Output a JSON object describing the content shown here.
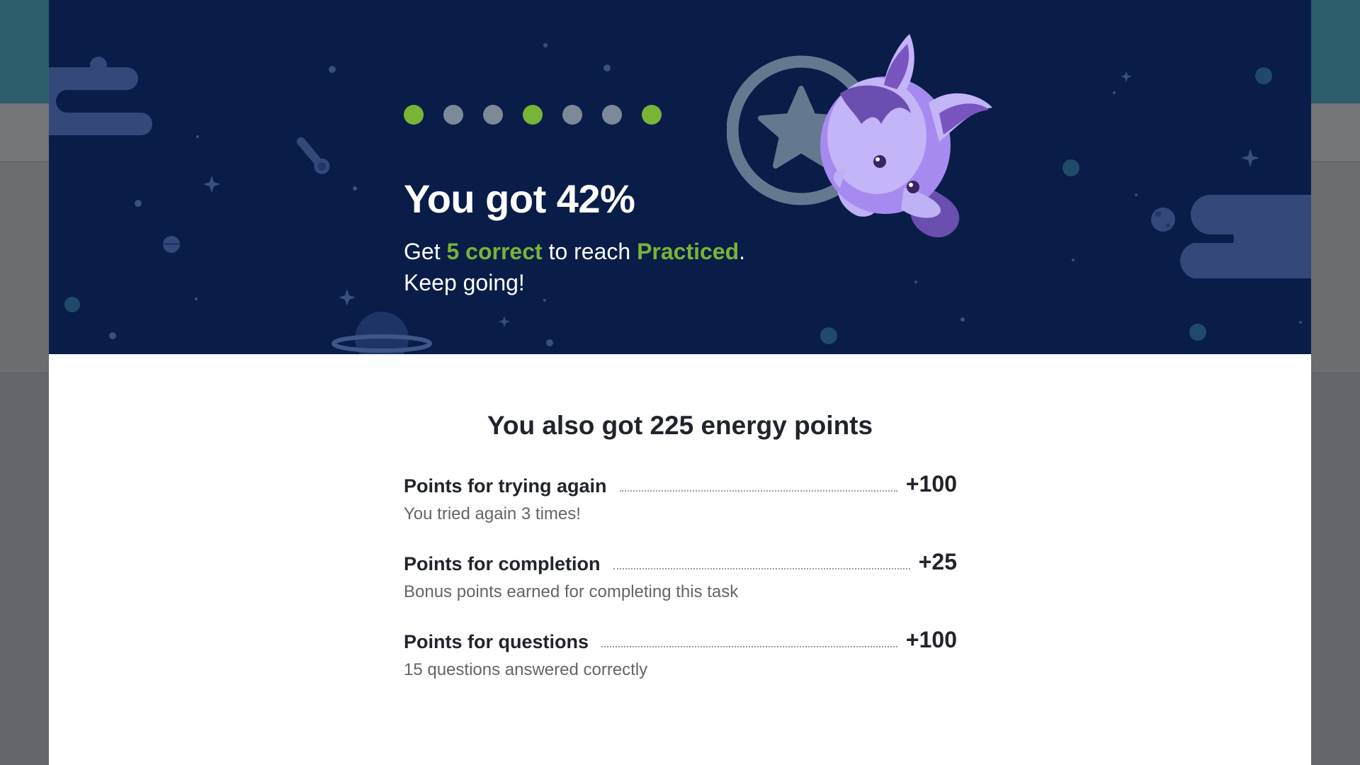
{
  "progress": {
    "dots": [
      {
        "state": "correct",
        "color": "#78b436"
      },
      {
        "state": "incorrect",
        "color": "#7d8899"
      },
      {
        "state": "incorrect",
        "color": "#7d8899"
      },
      {
        "state": "correct",
        "color": "#78b436"
      },
      {
        "state": "incorrect",
        "color": "#7d8899"
      },
      {
        "state": "incorrect",
        "color": "#7d8899"
      },
      {
        "state": "correct",
        "color": "#78b436"
      }
    ]
  },
  "hero": {
    "title": "You got 42%",
    "sub_prefix": "Get ",
    "sub_correct": "5 correct",
    "sub_middle": " to reach ",
    "sub_level": "Practiced",
    "sub_period": ".",
    "sub_line2": "Keep going!",
    "badge_icon": "star-badge-icon",
    "mascot_icon": "purple-creature-mascot",
    "background_color": "#0a1c48",
    "accent_color": "#78b436"
  },
  "energy": {
    "title": "You also got 225 energy points",
    "rows": [
      {
        "label": "Points for trying again",
        "value": "+100",
        "desc": "You tried again 3 times!"
      },
      {
        "label": "Points for completion",
        "value": "+25",
        "desc": "Bonus points earned for completing this task"
      },
      {
        "label": "Points for questions",
        "value": "+100",
        "desc": "15 questions answered correctly"
      }
    ]
  }
}
